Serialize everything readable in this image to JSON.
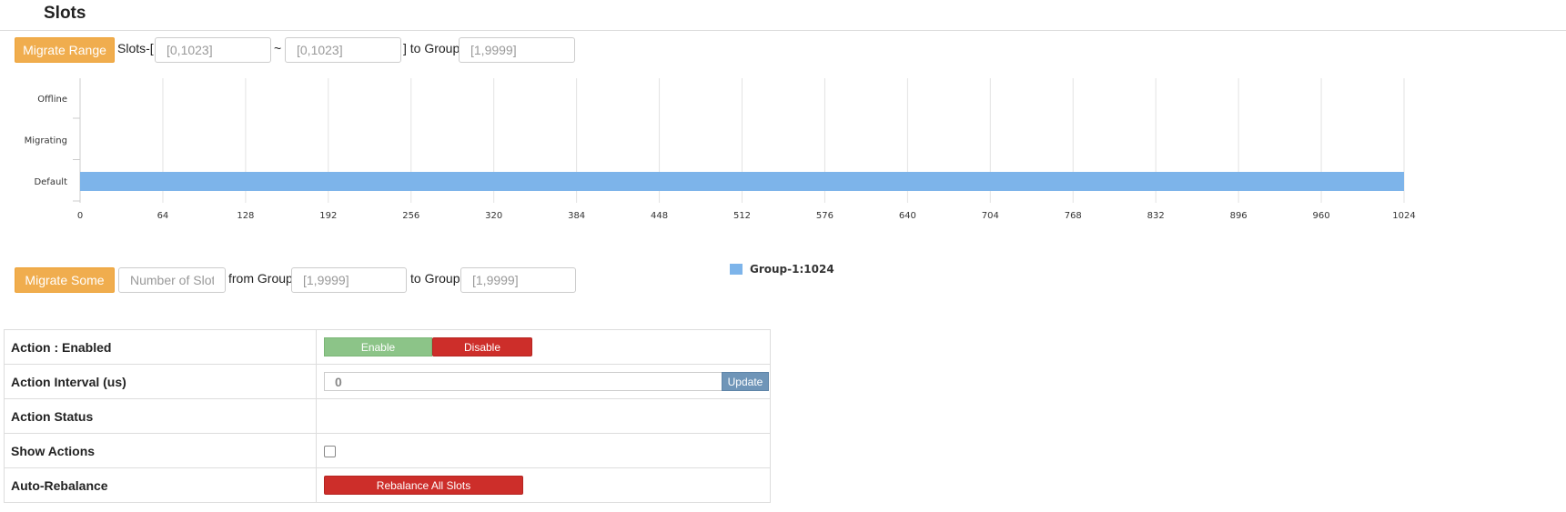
{
  "page": {
    "title": "Slots"
  },
  "migrate_range": {
    "button_label": "Migrate Range",
    "prefix_label": "Slots-[",
    "from_placeholder": "[0,1023]",
    "separator_label": "~",
    "to_placeholder": "[0,1023]",
    "suffix_label": "] to Group",
    "group_placeholder": "[1,9999]"
  },
  "chart_data": {
    "type": "bar",
    "orientation": "horizontal",
    "stacked": true,
    "categories": [
      "Offline",
      "Migrating",
      "Default"
    ],
    "series": [
      {
        "name": "Group-1:1024",
        "color": "#7db4ea",
        "ranges": {
          "Offline": [],
          "Migrating": [],
          "Default": [
            [
              0,
              1024
            ]
          ]
        }
      }
    ],
    "xlim": [
      0,
      1024
    ],
    "xticks": [
      0,
      64,
      128,
      192,
      256,
      320,
      384,
      448,
      512,
      576,
      640,
      704,
      768,
      832,
      896,
      960,
      1024
    ],
    "grid": true,
    "legend_position": "bottom-center"
  },
  "migrate_some": {
    "button_label": "Migrate Some",
    "count_placeholder": "Number of Slots",
    "from_label": "from Group",
    "from_placeholder": "[1,9999]",
    "to_label": "to Group",
    "to_placeholder": "[1,9999]"
  },
  "settings": {
    "action_label": "Action : Enabled",
    "enable_label": "Enable",
    "disable_label": "Disable",
    "interval_label": "Action Interval (us)",
    "interval_value": "0",
    "update_label": "Update",
    "status_label": "Action Status",
    "status_value": "",
    "show_actions_label": "Show Actions",
    "show_actions_checked": false,
    "auto_rebalance_label": "Auto-Rebalance",
    "rebalance_label": "Rebalance All Slots"
  },
  "colors": {
    "orange": "#f0ad4e",
    "green": "#8cc488",
    "red": "#cd2e2a",
    "blue_bar": "#7db4ea",
    "update_blue": "#6f95b8"
  }
}
